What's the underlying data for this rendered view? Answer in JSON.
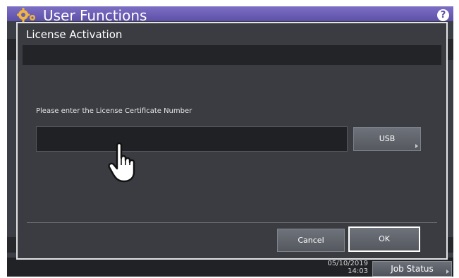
{
  "header": {
    "title": "User Functions",
    "help_icon": "?"
  },
  "dialog": {
    "title": "License Activation",
    "prompt": "Please enter the License Certificate Number",
    "license_value": "",
    "usb_label": "USB",
    "cancel_label": "Cancel",
    "ok_label": "OK"
  },
  "footer": {
    "date": "05/10/2019",
    "time": "14:03",
    "job_status_label": "Job Status"
  },
  "colors": {
    "title_bar": "#6a5cb8",
    "screen_bg": "#3b3e44",
    "dialog_border": "#e4e4e4"
  }
}
